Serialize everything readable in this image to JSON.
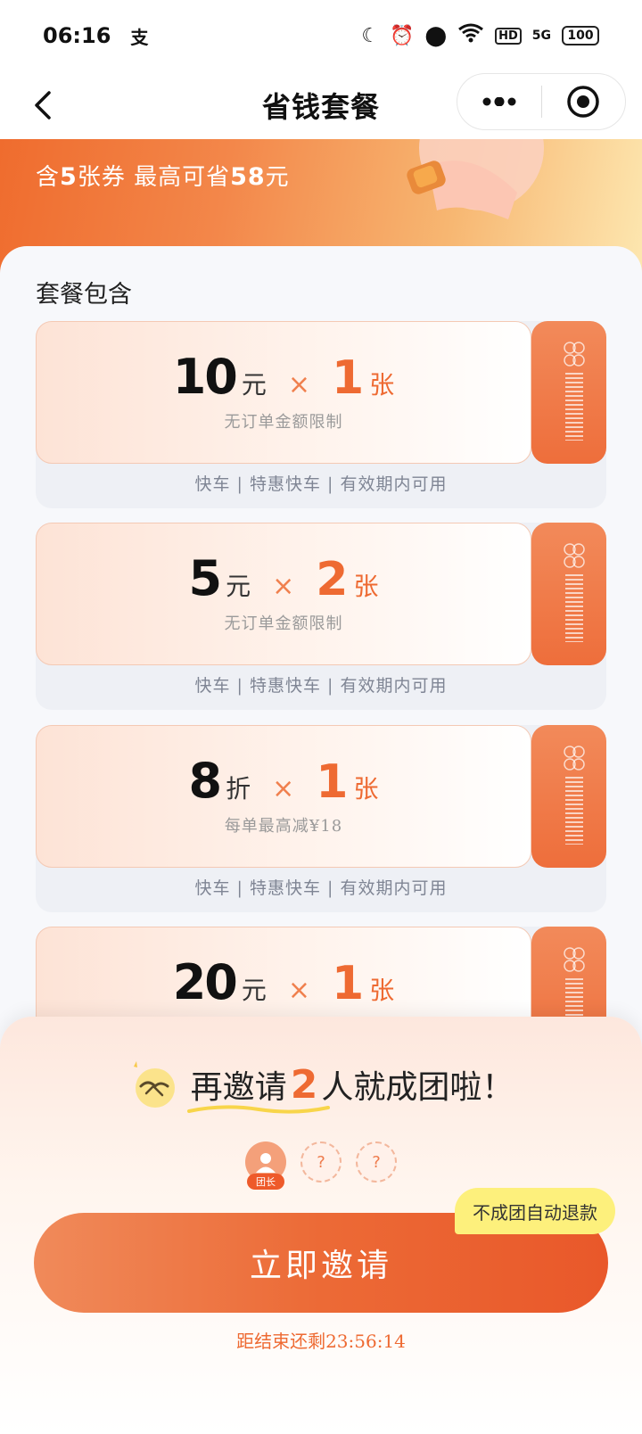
{
  "status_bar": {
    "time": "06:16",
    "app_icon": "支",
    "hd": "HD",
    "network": "5G",
    "battery": "100"
  },
  "nav": {
    "title": "省钱套餐"
  },
  "banner": {
    "prefix": "含",
    "coupon_count": "5",
    "mid": "张券 最高可省",
    "max_saving": "58",
    "suffix": "元"
  },
  "package": {
    "section_title": "套餐包含",
    "coupons": [
      {
        "amount": "10",
        "unit": "元",
        "times": "×",
        "count": "1",
        "count_unit": "张",
        "desc": "无订单金额限制",
        "meta": "快车 | 特惠快车 | 有效期内可用"
      },
      {
        "amount": "5",
        "unit": "元",
        "times": "×",
        "count": "2",
        "count_unit": "张",
        "desc": "无订单金额限制",
        "meta": "快车 | 特惠快车 | 有效期内可用"
      },
      {
        "amount": "8",
        "unit": "折",
        "times": "×",
        "count": "1",
        "count_unit": "张",
        "desc": "每单最高减¥18",
        "meta": "快车 | 特惠快车 | 有效期内可用"
      },
      {
        "amount": "20",
        "unit": "元",
        "times": "×",
        "count": "1",
        "count_unit": "张",
        "desc": "",
        "meta": ""
      }
    ]
  },
  "invite": {
    "headline_prefix": "再邀请",
    "needed": "2",
    "headline_suffix": "人就成团啦！",
    "leader_badge": "团长",
    "empty_slot": "?",
    "refund_tag": "不成团自动退款",
    "button": "立即邀请",
    "countdown_label": "距结束还剩",
    "countdown": "23:56:14"
  }
}
